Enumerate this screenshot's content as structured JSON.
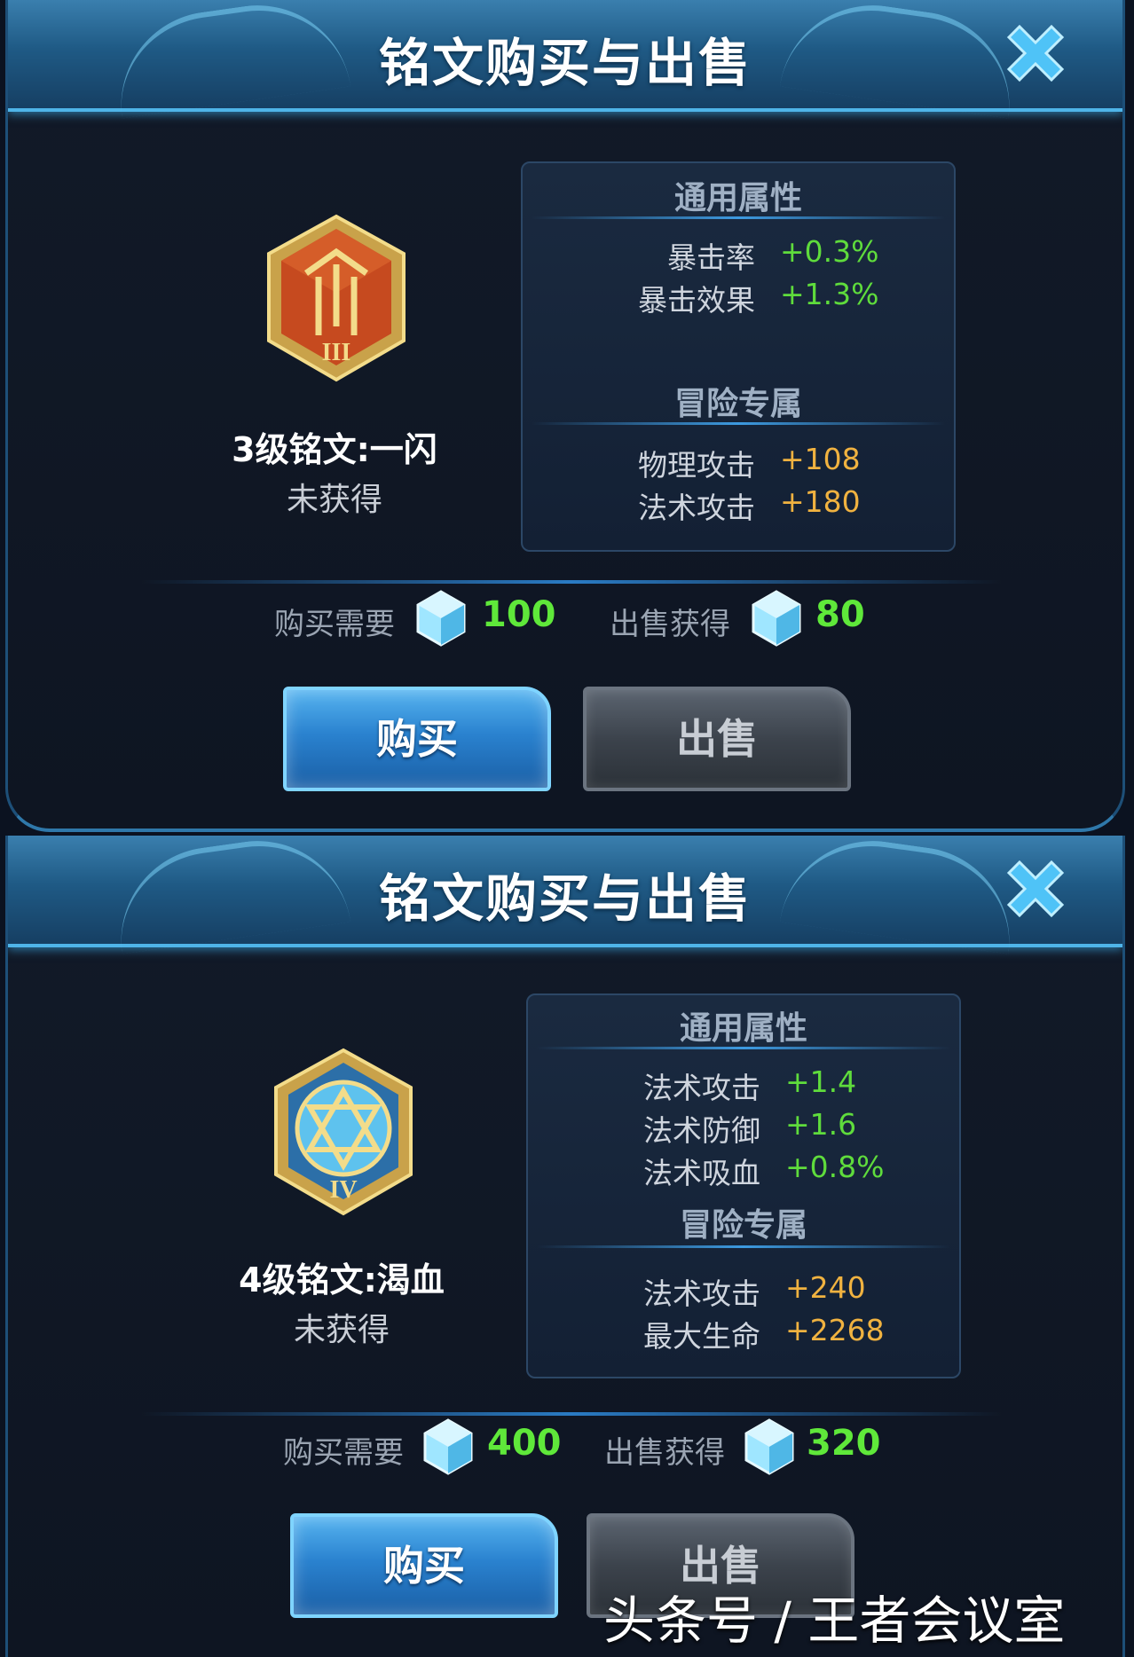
{
  "dialogs": [
    {
      "title": "铭文购买与出售",
      "rune": {
        "icon": "red-rune-level-3-icon",
        "roman": "III",
        "name": "3级铭文:一闪",
        "status": "未获得"
      },
      "general": {
        "title": "通用属性",
        "stats": [
          {
            "label": "暴击率",
            "value": "+0.3%"
          },
          {
            "label": "暴击效果",
            "value": "+1.3%"
          }
        ]
      },
      "adventure": {
        "title": "冒险专属",
        "stats": [
          {
            "label": "物理攻击",
            "value": "+108"
          },
          {
            "label": "法术攻击",
            "value": "+180"
          }
        ]
      },
      "price": {
        "buy_label": "购买需要",
        "buy_value": "100",
        "sell_label": "出售获得",
        "sell_value": "80"
      },
      "buttons": {
        "buy": "购买",
        "sell": "出售"
      }
    },
    {
      "title": "铭文购买与出售",
      "rune": {
        "icon": "blue-rune-level-4-icon",
        "roman": "IV",
        "name": "4级铭文:渴血",
        "status": "未获得"
      },
      "general": {
        "title": "通用属性",
        "stats": [
          {
            "label": "法术攻击",
            "value": "+1.4"
          },
          {
            "label": "法术防御",
            "value": "+1.6"
          },
          {
            "label": "法术吸血",
            "value": "+0.8%"
          }
        ]
      },
      "adventure": {
        "title": "冒险专属",
        "stats": [
          {
            "label": "法术攻击",
            "value": "+240"
          },
          {
            "label": "最大生命",
            "value": "+2268"
          }
        ]
      },
      "price": {
        "buy_label": "购买需要",
        "buy_value": "400",
        "sell_label": "出售获得",
        "sell_value": "320"
      },
      "buttons": {
        "buy": "购买",
        "sell": "出售"
      }
    }
  ],
  "watermark": "头条号 / 王者会议室",
  "colors": {
    "header_blue": "#2f78aa",
    "general_value_green": "#5fdc3c",
    "adventure_value_orange": "#f0b240",
    "price_green": "#5fe83a",
    "buy_button_blue": "#2a82cf",
    "sell_button_gray": "#3c434c"
  }
}
